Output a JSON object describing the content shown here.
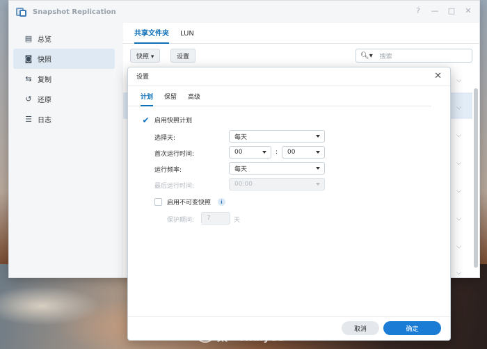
{
  "app": {
    "title": "Snapshot Replication"
  },
  "window_controls": [
    "?",
    "—",
    "□",
    "✕"
  ],
  "sidebar": {
    "items": [
      {
        "label": "总览",
        "icon": "overview-icon",
        "glyph": "▤",
        "active": false
      },
      {
        "label": "快照",
        "icon": "camera-icon",
        "glyph": "◙",
        "active": true
      },
      {
        "label": "复制",
        "icon": "replication-icon",
        "glyph": "⇆",
        "active": false
      },
      {
        "label": "还原",
        "icon": "restore-icon",
        "glyph": "↺",
        "active": false
      },
      {
        "label": "日志",
        "icon": "log-icon",
        "glyph": "☰",
        "active": false
      }
    ]
  },
  "main": {
    "tabs": [
      {
        "label": "共享文件夹",
        "active": true
      },
      {
        "label": "LUN",
        "active": false
      }
    ],
    "toolbar": {
      "snapshot_button": "快照 ▾",
      "settings_button": "设置",
      "search_placeholder": "搜索"
    }
  },
  "dialog": {
    "title": "设置",
    "tabs": [
      {
        "label": "计划",
        "active": true
      },
      {
        "label": "保留",
        "active": false
      },
      {
        "label": "高级",
        "active": false
      }
    ],
    "enable_schedule": {
      "label": "启用快照计划",
      "checked": true
    },
    "select_day": {
      "label": "选择天:",
      "value": "每天"
    },
    "first_run_time": {
      "label": "首次运行时间:",
      "hour": "00",
      "separator": ":",
      "minute": "00"
    },
    "frequency": {
      "label": "运行频率:",
      "value": "每天"
    },
    "last_run_time": {
      "label": "最后运行时间:",
      "value": "00:00"
    },
    "immutable": {
      "label": "启用不可变快照",
      "checked": false,
      "info": "i"
    },
    "protection": {
      "label": "保护期间:",
      "value": "7",
      "unit": "天"
    },
    "buttons": {
      "cancel": "取消",
      "ok": "确定"
    }
  },
  "watermark": {
    "text": "太一Thalyee"
  },
  "colors": {
    "accent": "#0c6fb9",
    "primary_button": "#1a7cd4",
    "sidebar_active": "#dfe9f3"
  }
}
